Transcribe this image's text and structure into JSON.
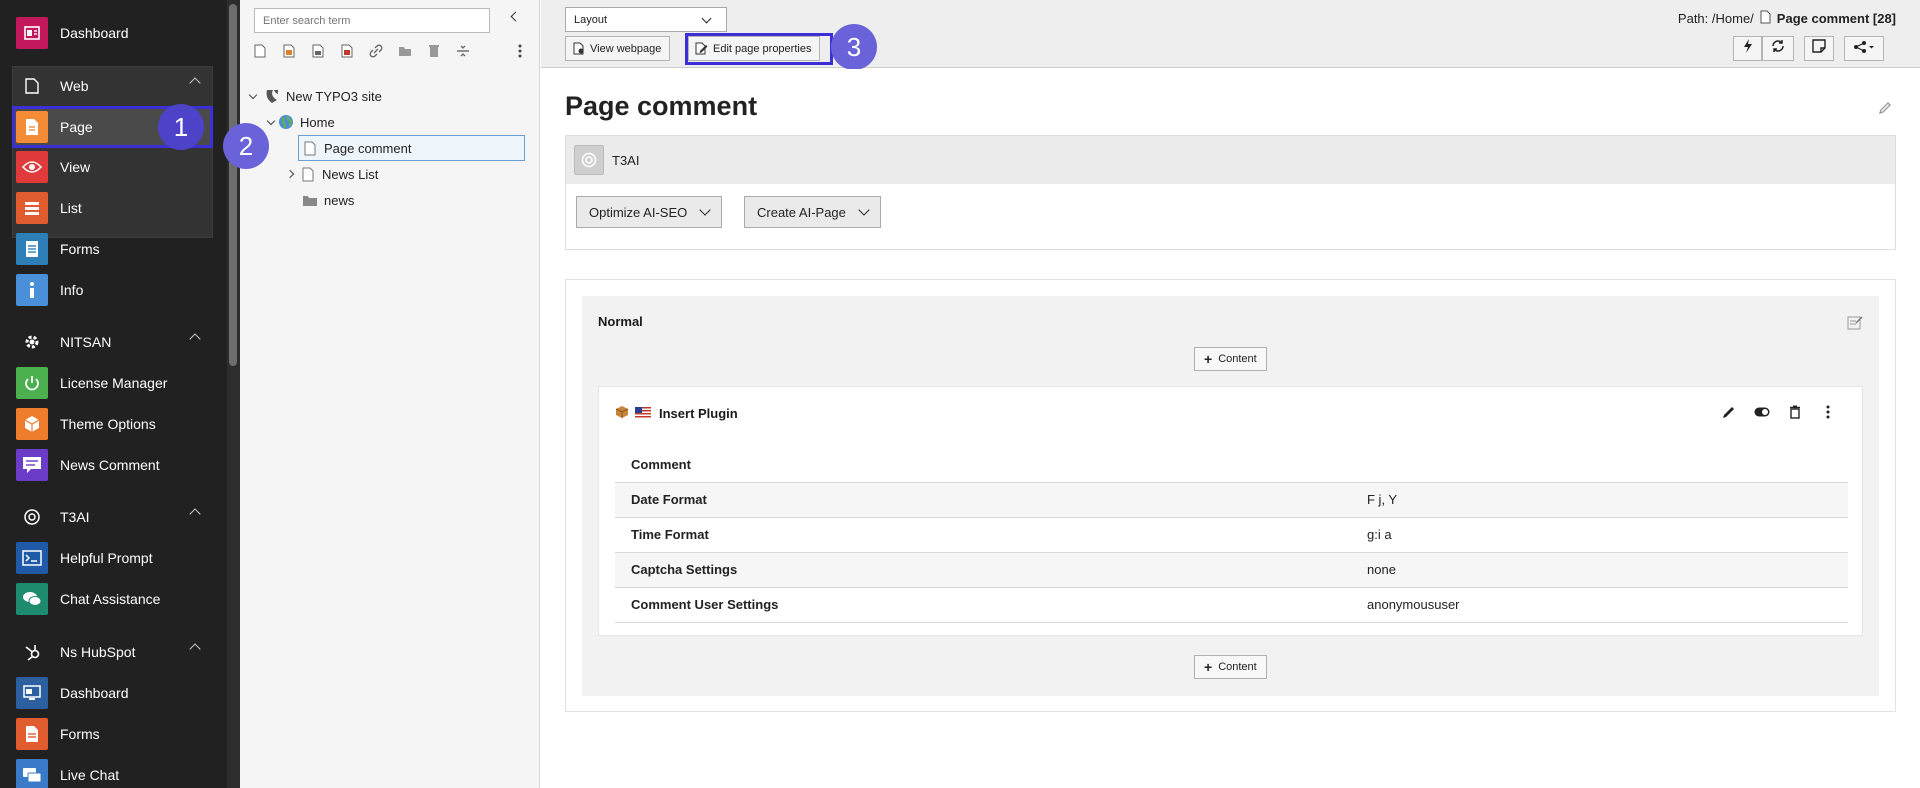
{
  "sidebar": {
    "items": [
      {
        "label": "Dashboard",
        "color": "#c2185b",
        "icon": "dashboard-icon"
      },
      {
        "label": "Web",
        "icon": "file-icon"
      },
      {
        "label": "Page",
        "color": "#f38b37",
        "icon": "page-icon"
      },
      {
        "label": "View",
        "color": "#e03a3a",
        "icon": "eye-icon"
      },
      {
        "label": "List",
        "color": "#e05b2e",
        "icon": "list-icon"
      },
      {
        "label": "Forms",
        "color": "#2e7fb8",
        "icon": "form-icon"
      },
      {
        "label": "Info",
        "color": "#4a90d9",
        "icon": "info-icon"
      },
      {
        "label": "NITSAN",
        "icon": "gear-icon"
      },
      {
        "label": "License Manager",
        "color": "#4caf50",
        "icon": "power-icon"
      },
      {
        "label": "Theme Options",
        "color": "#f07d2d",
        "icon": "cube-icon"
      },
      {
        "label": "News Comment",
        "color": "#6a3cc8",
        "icon": "comment-icon"
      },
      {
        "label": "T3AI",
        "icon": "ai-icon"
      },
      {
        "label": "Helpful Prompt",
        "color": "#1e5aa8",
        "icon": "terminal-icon"
      },
      {
        "label": "Chat Assistance",
        "color": "#1e8a6e",
        "icon": "chat-icon"
      },
      {
        "label": "Ns HubSpot",
        "icon": "hubspot-icon"
      },
      {
        "label": "Dashboard",
        "color": "#2c5fa0",
        "icon": "dashboard-icon"
      },
      {
        "label": "Forms",
        "color": "#e05b2e",
        "icon": "form-icon"
      },
      {
        "label": "Live Chat",
        "color": "#3a7bc8",
        "icon": "chat-icon"
      }
    ]
  },
  "steps": [
    "1",
    "2",
    "3"
  ],
  "tree": {
    "search_placeholder": "Enter search term",
    "nodes": [
      {
        "label": "New TYPO3 site"
      },
      {
        "label": "Home"
      },
      {
        "label": "Page comment"
      },
      {
        "label": "News List"
      },
      {
        "label": "news"
      }
    ]
  },
  "header": {
    "layout_select": "Layout",
    "view_webpage": "View webpage",
    "edit_page_properties": "Edit page properties",
    "path_prefix": "Path: /Home/",
    "path_current": "Page comment [28]"
  },
  "content": {
    "page_title": "Page comment",
    "t3ai_name": "T3AI",
    "optimize_label": "Optimize AI-SEO",
    "create_label": "Create AI-Page",
    "column_title": "Normal",
    "add_content_label": "Content",
    "ce_title": "Insert Plugin",
    "ce_rows": [
      {
        "key": "Comment",
        "value": ""
      },
      {
        "key": "Date Format",
        "value": "F j, Y"
      },
      {
        "key": "Time Format",
        "value": "g:i a"
      },
      {
        "key": "Captcha Settings",
        "value": "none"
      },
      {
        "key": "Comment User Settings",
        "value": "anonymoususer"
      }
    ]
  }
}
